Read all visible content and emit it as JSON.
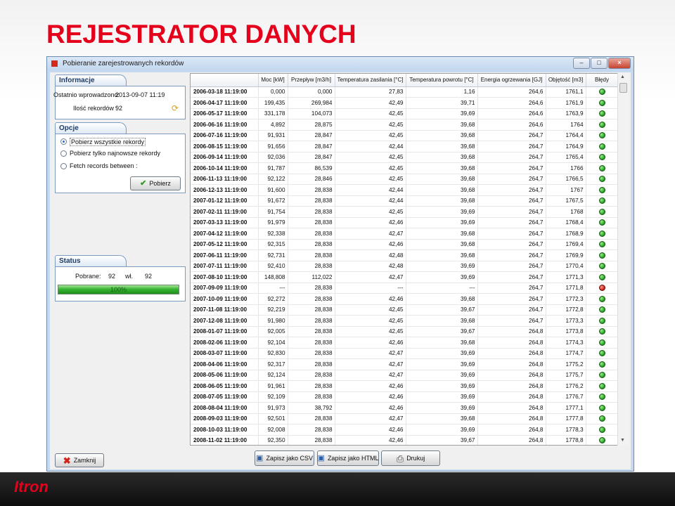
{
  "slide": {
    "title": "REJESTRATOR DANYCH",
    "footer_logo": "Itron"
  },
  "window": {
    "title": "Pobieranie zarejestrowanych rekordów",
    "minimize": "–",
    "maximize": "□",
    "close": "×"
  },
  "info_panel": {
    "tab": "Informacje",
    "last_read_label": "Ostatnio wprowadzono:",
    "last_read_value": "2013-09-07 11:19",
    "record_count_label": "Ilość rekordów :",
    "record_count_value": "92"
  },
  "options_panel": {
    "tab": "Opcje",
    "options": [
      "Pobierz wszystkie rekordy",
      "Pobierz tylko najnowsze rekordy",
      "Fetch records between :"
    ],
    "selected_index": 0,
    "fetch_button": "Pobierz"
  },
  "status_panel": {
    "tab": "Status",
    "downloaded_label": "Pobrane:",
    "downloaded_value": "92",
    "of_label": "wł.",
    "total_value": "92",
    "progress_text": "100%",
    "progress_fraction": 1.0
  },
  "table": {
    "columns": [
      "",
      "Moc [kW]",
      "Przepływ [m3/h]",
      "Temperatura zasilania [°C]",
      "Temperatura powrotu [°C]",
      "Energia ogrzewania [GJ]",
      "Objętość [m3]",
      "Błędy"
    ],
    "rows": [
      [
        "2006-03-18 11:19:00",
        "0,000",
        "0,000",
        "27,83",
        "1,16",
        "264,6",
        "1761,1",
        "ok"
      ],
      [
        "2006-04-17 11:19:00",
        "199,435",
        "269,984",
        "42,49",
        "39,71",
        "264,6",
        "1761,9",
        "ok"
      ],
      [
        "2006-05-17 11:19:00",
        "331,178",
        "104,073",
        "42,45",
        "39,69",
        "264,6",
        "1763,9",
        "ok"
      ],
      [
        "2006-06-16 11:19:00",
        "4,892",
        "28,875",
        "42,45",
        "39,68",
        "264,6",
        "1764",
        "ok"
      ],
      [
        "2006-07-16 11:19:00",
        "91,931",
        "28,847",
        "42,45",
        "39,68",
        "264,7",
        "1764,4",
        "ok"
      ],
      [
        "2006-08-15 11:19:00",
        "91,656",
        "28,847",
        "42,44",
        "39,68",
        "264,7",
        "1764,9",
        "ok"
      ],
      [
        "2006-09-14 11:19:00",
        "92,036",
        "28,847",
        "42,45",
        "39,68",
        "264,7",
        "1765,4",
        "ok"
      ],
      [
        "2006-10-14 11:19:00",
        "91,787",
        "86,539",
        "42,45",
        "39,68",
        "264,7",
        "1766",
        "ok"
      ],
      [
        "2006-11-13 11:19:00",
        "92,122",
        "28,846",
        "42,45",
        "39,68",
        "264,7",
        "1766,5",
        "ok"
      ],
      [
        "2006-12-13 11:19:00",
        "91,600",
        "28,838",
        "42,44",
        "39,68",
        "264,7",
        "1767",
        "ok"
      ],
      [
        "2007-01-12 11:19:00",
        "91,672",
        "28,838",
        "42,44",
        "39,68",
        "264,7",
        "1767,5",
        "ok"
      ],
      [
        "2007-02-11 11:19:00",
        "91,754",
        "28,838",
        "42,45",
        "39,69",
        "264,7",
        "1768",
        "ok"
      ],
      [
        "2007-03-13 11:19:00",
        "91,979",
        "28,838",
        "42,46",
        "39,69",
        "264,7",
        "1768,4",
        "ok"
      ],
      [
        "2007-04-12 11:19:00",
        "92,338",
        "28,838",
        "42,47",
        "39,68",
        "264,7",
        "1768,9",
        "ok"
      ],
      [
        "2007-05-12 11:19:00",
        "92,315",
        "28,838",
        "42,46",
        "39,68",
        "264,7",
        "1769,4",
        "ok"
      ],
      [
        "2007-06-11 11:19:00",
        "92,731",
        "28,838",
        "42,48",
        "39,68",
        "264,7",
        "1769,9",
        "ok"
      ],
      [
        "2007-07-11 11:19:00",
        "92,410",
        "28,838",
        "42,48",
        "39,69",
        "264,7",
        "1770,4",
        "ok"
      ],
      [
        "2007-08-10 11:19:00",
        "148,808",
        "112,022",
        "42,47",
        "39,69",
        "264,7",
        "1771,3",
        "ok"
      ],
      [
        "2007-09-09 11:19:00",
        "---",
        "28,838",
        "---",
        "---",
        "264,7",
        "1771,8",
        "err"
      ],
      [
        "2007-10-09 11:19:00",
        "92,272",
        "28,838",
        "42,46",
        "39,68",
        "264,7",
        "1772,3",
        "ok"
      ],
      [
        "2007-11-08 11:19:00",
        "92,219",
        "28,838",
        "42,45",
        "39,67",
        "264,7",
        "1772,8",
        "ok"
      ],
      [
        "2007-12-08 11:19:00",
        "91,980",
        "28,838",
        "42,45",
        "39,68",
        "264,7",
        "1773,3",
        "ok"
      ],
      [
        "2008-01-07 11:19:00",
        "92,005",
        "28,838",
        "42,45",
        "39,67",
        "264,8",
        "1773,8",
        "ok"
      ],
      [
        "2008-02-06 11:19:00",
        "92,104",
        "28,838",
        "42,46",
        "39,68",
        "264,8",
        "1774,3",
        "ok"
      ],
      [
        "2008-03-07 11:19:00",
        "92,830",
        "28,838",
        "42,47",
        "39,69",
        "264,8",
        "1774,7",
        "ok"
      ],
      [
        "2008-04-06 11:19:00",
        "92,317",
        "28,838",
        "42,47",
        "39,69",
        "264,8",
        "1775,2",
        "ok"
      ],
      [
        "2008-05-06 11:19:00",
        "92,124",
        "28,838",
        "42,47",
        "39,69",
        "264,8",
        "1775,7",
        "ok"
      ],
      [
        "2008-06-05 11:19:00",
        "91,961",
        "28,838",
        "42,46",
        "39,69",
        "264,8",
        "1776,2",
        "ok"
      ],
      [
        "2008-07-05 11:19:00",
        "92,109",
        "28,838",
        "42,46",
        "39,69",
        "264,8",
        "1776,7",
        "ok"
      ],
      [
        "2008-08-04 11:19:00",
        "91,973",
        "38,792",
        "42,46",
        "39,69",
        "264,8",
        "1777,1",
        "ok"
      ],
      [
        "2008-09-03 11:19:00",
        "92,501",
        "28,838",
        "42,47",
        "39,68",
        "264,8",
        "1777,8",
        "ok"
      ],
      [
        "2008-10-03 11:19:00",
        "92,008",
        "28,838",
        "42,46",
        "39,69",
        "264,8",
        "1778,3",
        "ok"
      ],
      [
        "2008-11-02 11:19:00",
        "92,350",
        "28,838",
        "42,46",
        "39,67",
        "264,8",
        "1778,8",
        "ok"
      ]
    ]
  },
  "buttons": {
    "close": "Zamknij",
    "save_csv": "Zapisz jako CSV",
    "save_html": "Zapisz jako HTML",
    "print": "Drukuj"
  },
  "icons": {
    "close_button_icon": "red-x-icon",
    "fetch_icon": "green-check-icon",
    "csv_icon": "save-disk-icon",
    "html_icon": "save-disk-icon",
    "print_icon": "printer-icon",
    "refresh_icon": "refresh-icon"
  },
  "colors": {
    "title_red": "#e5001c",
    "ok_green": "#1c9a1c",
    "error_red": "#c41a0e",
    "window_frame": "#c6d9ef"
  }
}
